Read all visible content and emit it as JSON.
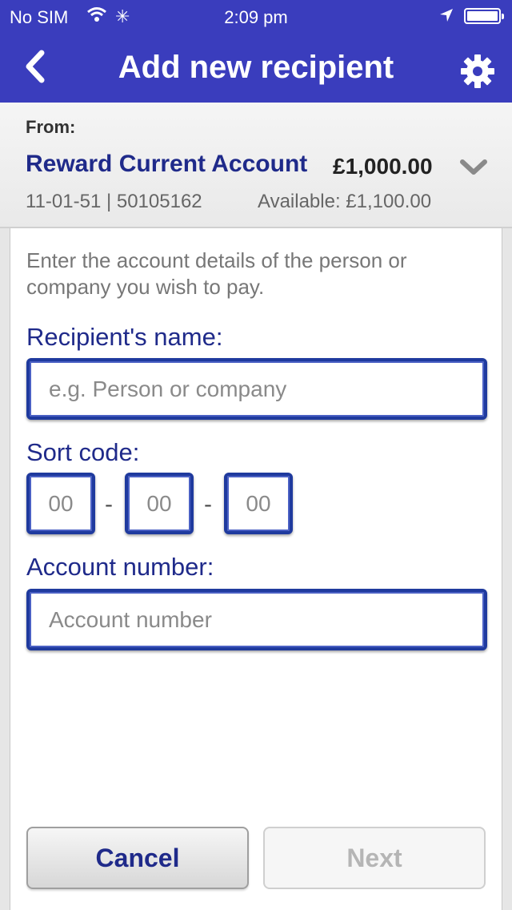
{
  "status_bar": {
    "carrier": "No SIM",
    "time": "2:09 pm"
  },
  "nav": {
    "title": "Add new recipient"
  },
  "from": {
    "label": "From:",
    "account_name": "Reward Current Account",
    "balance": "£1,000.00",
    "sort_account": "11-01-51 | 50105162",
    "available": "Available: £1,100.00"
  },
  "form": {
    "intro": "Enter the account details of the person or company you wish to pay.",
    "name_label": "Recipient's name:",
    "name_placeholder": "e.g. Person or company",
    "sort_label": "Sort code:",
    "sort_placeholder": "00",
    "sort_separator": "-",
    "account_label": "Account number:",
    "account_placeholder": "Account number"
  },
  "buttons": {
    "cancel": "Cancel",
    "next": "Next"
  },
  "colors": {
    "nav_bar": "#3a3dbd",
    "accent_text": "#1f2a8a",
    "field_border": "#1f3a9e"
  }
}
